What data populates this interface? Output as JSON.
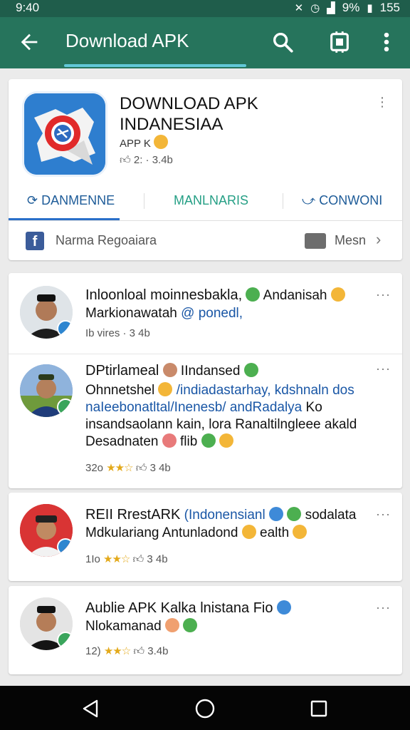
{
  "status": {
    "time": "9:40",
    "battery": "9%",
    "right_num": "155"
  },
  "appbar": {
    "title": "Download APK"
  },
  "app": {
    "name": "DOWNLOAD APK INDANESIAA",
    "sub": "APP K",
    "stats": "2: · 3.4b",
    "tabs": [
      "DANMENNE",
      "MANLNARIS",
      "CONWONI"
    ],
    "reg_label": "Narma Regoaiara",
    "msn_label": "Mesn"
  },
  "posts": [
    {
      "line1_a": "Inloonloal moinnesbakla,",
      "line1_b": "Andanisah",
      "line2_a": "Markionawatah",
      "line2_b": "@ ponedl,",
      "meta": "Ib vires · 3 4b"
    },
    {
      "line1_a": "DPtirlameal",
      "line1_b": "IIndansed",
      "line2_a": "Ohnnetshel",
      "line2_b": "/indiadastarhay, kdshnaln dos",
      "line3": "naIeebonatltal/Inenesb/ andRadalya",
      "line3_b": "Ko",
      "line4": "insandsaolann kain, lora Ranaltilngleee akald",
      "line5_a": "Desadnaten",
      "line5_b": "flib",
      "meta_a": "32o",
      "meta_b": "3 4b"
    },
    {
      "line1_a": "REII RrestARK",
      "line1_b": "(Indonensianl",
      "line1_c": "sodalata",
      "line2_a": "Mdkulariang Antunladond",
      "line2_b": "ealth",
      "meta_a": "1Io",
      "meta_b": "3 4b"
    },
    {
      "line1": "Aublie APK Kalka lnistana Fio",
      "line2": "Nlokamanad",
      "meta_a": "12)",
      "meta_b": "3.4b"
    }
  ]
}
